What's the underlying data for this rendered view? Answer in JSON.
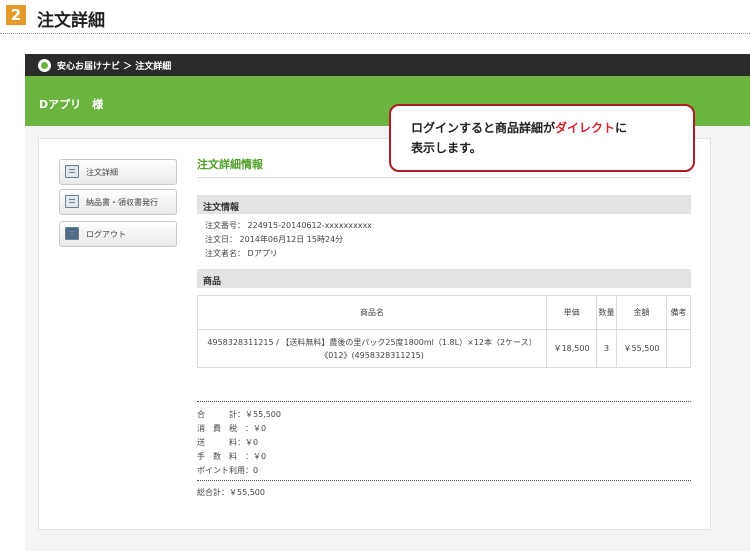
{
  "step": {
    "number": "2",
    "title": "注文詳細"
  },
  "app": {
    "breadcrumb": "安心お届けナビ ＞ 注文詳細",
    "user_label": "Dアプリ　様"
  },
  "sidebar": {
    "items": [
      {
        "label": "注文詳細",
        "icon": "document-icon"
      },
      {
        "label": "納品書・領収書発行",
        "icon": "receipt-icon"
      },
      {
        "label": "ログアウト",
        "icon": "logout-icon"
      }
    ]
  },
  "main": {
    "title": "注文詳細情報",
    "order_info": {
      "heading": "注文情報",
      "lines": [
        "注文番号： 224915-20140612-xxxxxxxxxx",
        "注文日： 2014年06月12日 15時24分",
        "注文者名： Dアプリ"
      ]
    },
    "products": {
      "heading": "商品",
      "columns": [
        "商品名",
        "単価",
        "数量",
        "金額",
        "備考"
      ],
      "rows": [
        {
          "name": "4958328311215 / 【送料無料】農後の里パック25度1800ml（1.8L）×12本（2ケース）《012》(4958328311215)",
          "price": "￥18,500",
          "qty": "3",
          "amount": "￥55,500",
          "note": ""
        }
      ]
    },
    "summary": {
      "lines": [
        "合　　　計：￥55,500",
        "消　費　税　：￥0",
        "送　　　料：￥0",
        "手　数　料　：￥0",
        "ポイント利用：0"
      ],
      "total": "総合計：￥55,500"
    }
  },
  "callout": {
    "before": "ログインすると商品詳細が",
    "highlight": "ダイレクト",
    "after": "に",
    "line2": "表示します。"
  },
  "colors": {
    "accent_green": "#6bb43f",
    "callout_red": "#b01c24",
    "step_orange": "#e49b2a"
  }
}
